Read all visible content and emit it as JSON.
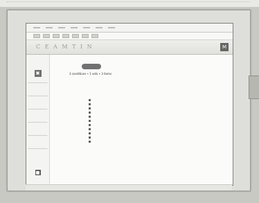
{
  "caption": "",
  "menu": [
    "",
    "",
    "",
    "",
    "",
    "",
    "",
    ""
  ],
  "toolbar": [
    "",
    "",
    "",
    "",
    "",
    "",
    ""
  ],
  "banner": {
    "title": "C E A M T I N",
    "logo": "M"
  },
  "main": {
    "section": "",
    "summary": "3 conditions  •  1  sets  • 3 items"
  },
  "sidebar": {
    "items": [
      "",
      "",
      "",
      "",
      "",
      ""
    ]
  },
  "links": [
    "",
    "",
    "",
    "",
    "",
    "",
    "",
    "",
    "",
    "",
    ""
  ],
  "footer": [
    "",
    ""
  ],
  "status": ""
}
